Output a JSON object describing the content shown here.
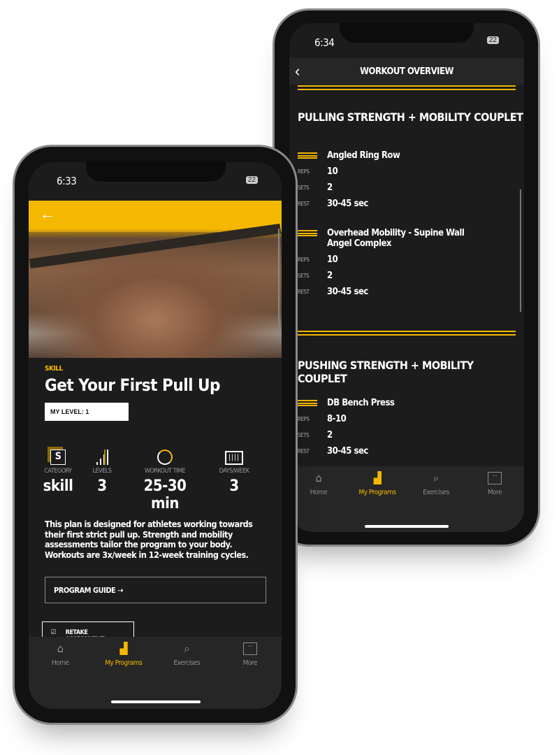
{
  "colors": {
    "accent": "#f5b800",
    "background": "#1c1c1c",
    "navbar": "#262626"
  },
  "back_phone": {
    "status": {
      "time": "6:34",
      "battery": "22"
    },
    "header": {
      "title": "WORKOUT OVERVIEW",
      "back_icon": "chevron-left-icon"
    },
    "sections": [
      {
        "title": "PULLING STRENGTH + MOBILITY COUPLET",
        "exercises": [
          {
            "name": "Angled Ring Row",
            "reps": "10",
            "sets": "2",
            "rest": "30-45 sec"
          },
          {
            "name": "Overhead Mobility - Supine Wall Angel Complex",
            "reps": "10",
            "sets": "2",
            "rest": "30-45 sec"
          }
        ]
      },
      {
        "title": "PUSHING STRENGTH + MOBILITY COUPLET",
        "exercises": [
          {
            "name": "DB Bench Press",
            "reps": "8-10",
            "sets": "2",
            "rest": "30-45 sec"
          }
        ]
      }
    ],
    "labels": {
      "reps": "REPS",
      "sets": "SETS",
      "rest": "REST"
    }
  },
  "front_phone": {
    "status": {
      "time": "6:33",
      "battery": "22"
    },
    "category_tag": "SKILL",
    "title": "Get Your First Pull Up",
    "my_level": "MY LEVEL: 1",
    "stats": [
      {
        "label": "CATEGORY",
        "value": "skill",
        "icon": "category-s-icon"
      },
      {
        "label": "LEVELS",
        "value": "3",
        "icon": "levels-bars-icon"
      },
      {
        "label": "WORKOUT TIME",
        "value": "25-30 min",
        "icon": "clock-icon"
      },
      {
        "label": "DAYS/WEEK",
        "value": "3",
        "icon": "calendar-days-icon"
      }
    ],
    "description": "This plan is designed for athletes working towards their first strict pull up. Strength and mobility assessments tailor the program to your body. Workouts are 3x/week in 12-week training cycles.",
    "program_guide": "PROGRAM GUIDE ⇢",
    "retake": "RETAKE ASSESSMENT"
  },
  "nav": [
    {
      "label": "Home",
      "icon": "home-icon",
      "active": false
    },
    {
      "label": "My Programs",
      "icon": "programs-arm-icon",
      "active": true
    },
    {
      "label": "Exercises",
      "icon": "exercises-search-icon",
      "active": false
    },
    {
      "label": "More",
      "icon": "more-icon",
      "active": false
    }
  ]
}
